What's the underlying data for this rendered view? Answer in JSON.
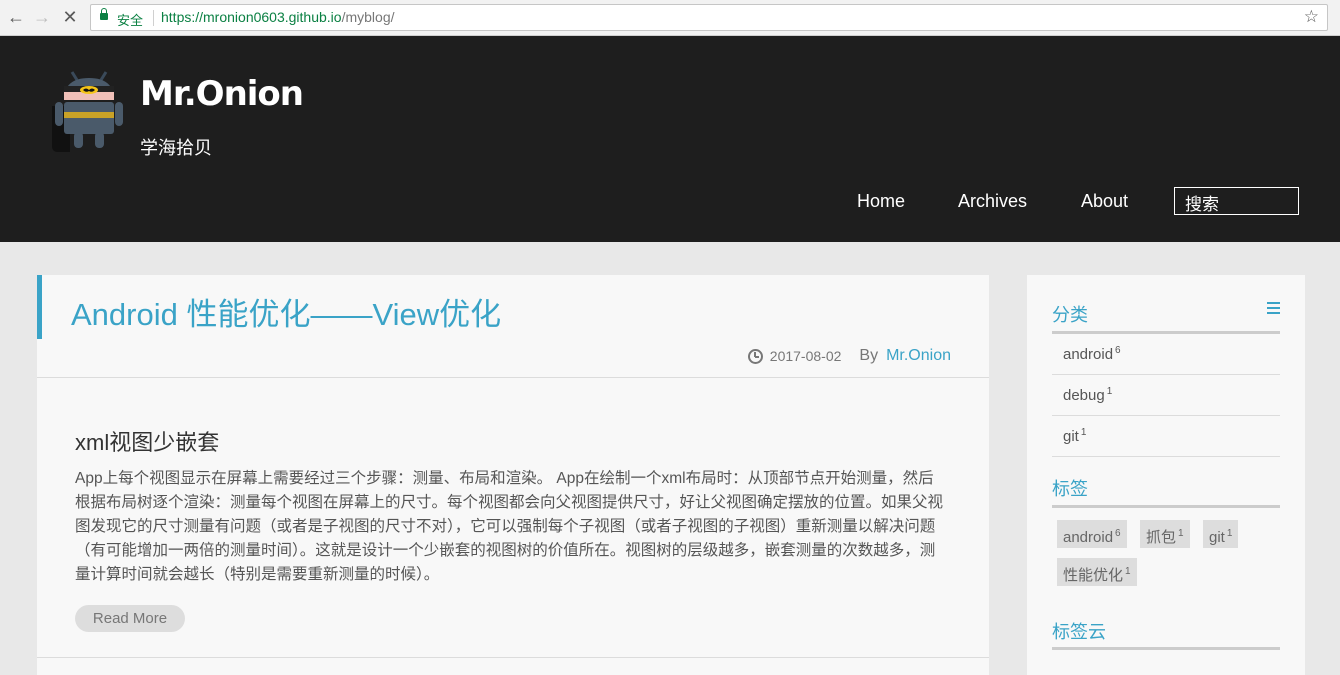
{
  "browser": {
    "secure_label": "安全",
    "url_host": "https://mronion0603.github.io",
    "url_path": "/myblog/"
  },
  "site": {
    "brand": "Mr.Onion",
    "tagline": "学海拾贝",
    "nav": [
      "Home",
      "Archives",
      "About"
    ],
    "search_label": "搜索"
  },
  "article": {
    "title": "Android 性能优化——View优化",
    "date": "2017-08-02",
    "by": "By",
    "author": "Mr.Onion",
    "heading": "xml视图少嵌套",
    "body": "App上每个视图显示在屏幕上需要经过三个步骤：测量、布局和渲染。 App在绘制一个xml布局时：从顶部节点开始测量，然后根据布局树逐个渲染：测量每个视图在屏幕上的尺寸。每个视图都会向父视图提供尺寸，好让父视图确定摆放的位置。如果父视图发现它的尺寸测量有问题（或者是子视图的尺寸不对），它可以强制每个子视图（或者子视图的子视图）重新测量以解决问题（有可能增加一两倍的测量时间）。这就是设计一个少嵌套的视图树的价值所在。视图树的层级越多，嵌套测量的次数越多，测量计算时间就会越长（特别是需要重新测量的时候）。",
    "read_more": "Read More"
  },
  "sidebar": {
    "categories_title": "分类",
    "categories": [
      {
        "name": "android",
        "count": "6"
      },
      {
        "name": "debug",
        "count": "1"
      },
      {
        "name": "git",
        "count": "1"
      }
    ],
    "tags_title": "标签",
    "tags": [
      {
        "name": "android",
        "count": "6"
      },
      {
        "name": "抓包",
        "count": "1"
      },
      {
        "name": "git",
        "count": "1"
      },
      {
        "name": "性能优化",
        "count": "1"
      }
    ],
    "cloud_title": "标签云"
  },
  "colors": {
    "accent": "#3aa3c7",
    "header_bg": "#1e1e1e",
    "page_bg": "#e8e8e8"
  }
}
